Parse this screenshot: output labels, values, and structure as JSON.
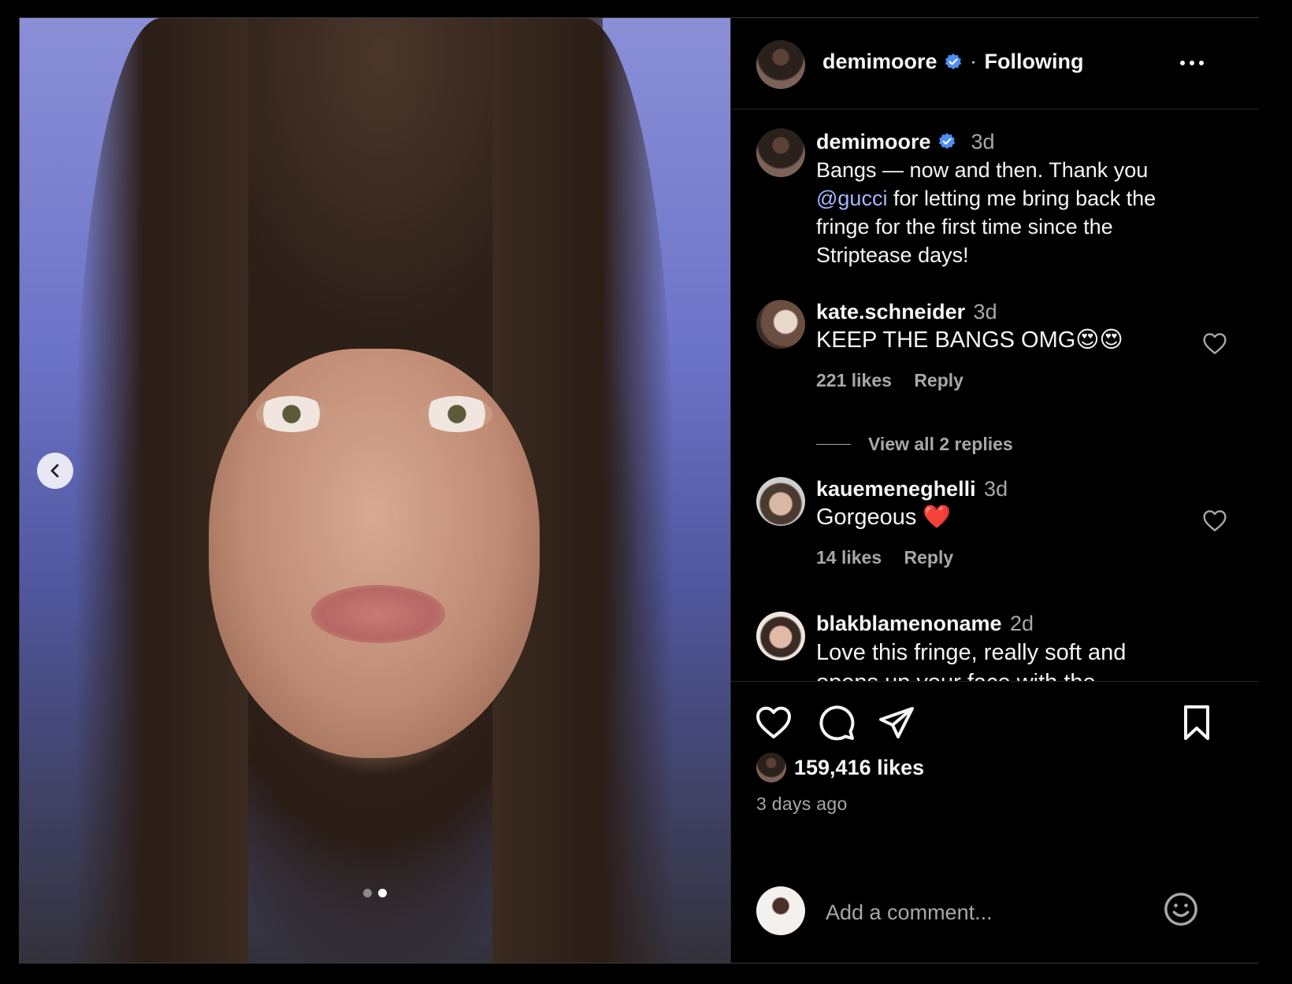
{
  "post": {
    "media": {
      "alt": "",
      "carousel_total": 2,
      "carousel_active": 2
    },
    "header": {
      "username": "demimoore",
      "separator": "·",
      "follow_status": "Following"
    },
    "caption": {
      "username": "demimoore",
      "time": "3d",
      "text_before": "Bangs — now and then. Thank you ",
      "mention": "@gucci",
      "text_after": " for letting me bring back the fringe for the first time since the Striptease days!"
    },
    "comments": [
      {
        "username": "kate.schneider",
        "time": "3d",
        "text": "KEEP THE BANGS OMG😍😍",
        "likes": "221 likes",
        "reply": "Reply",
        "view_replies": "View all 2 replies"
      },
      {
        "username": "kauemeneghelli",
        "time": "3d",
        "text": "Gorgeous ❤️",
        "likes": "14 likes",
        "reply": "Reply"
      },
      {
        "username": "blakblamenoname",
        "time": "2d",
        "text": "Love this fringe, really soft and opens up your face with the"
      }
    ],
    "stats": {
      "likes": "159,416 likes",
      "posted": "3 days ago"
    },
    "add_comment": {
      "placeholder": "Add a comment..."
    },
    "colors": {
      "verified": "#4b8ef5",
      "mention": "#a7b6ff",
      "muted": "#a8a8a8",
      "heart_red": "#e0312f"
    }
  }
}
